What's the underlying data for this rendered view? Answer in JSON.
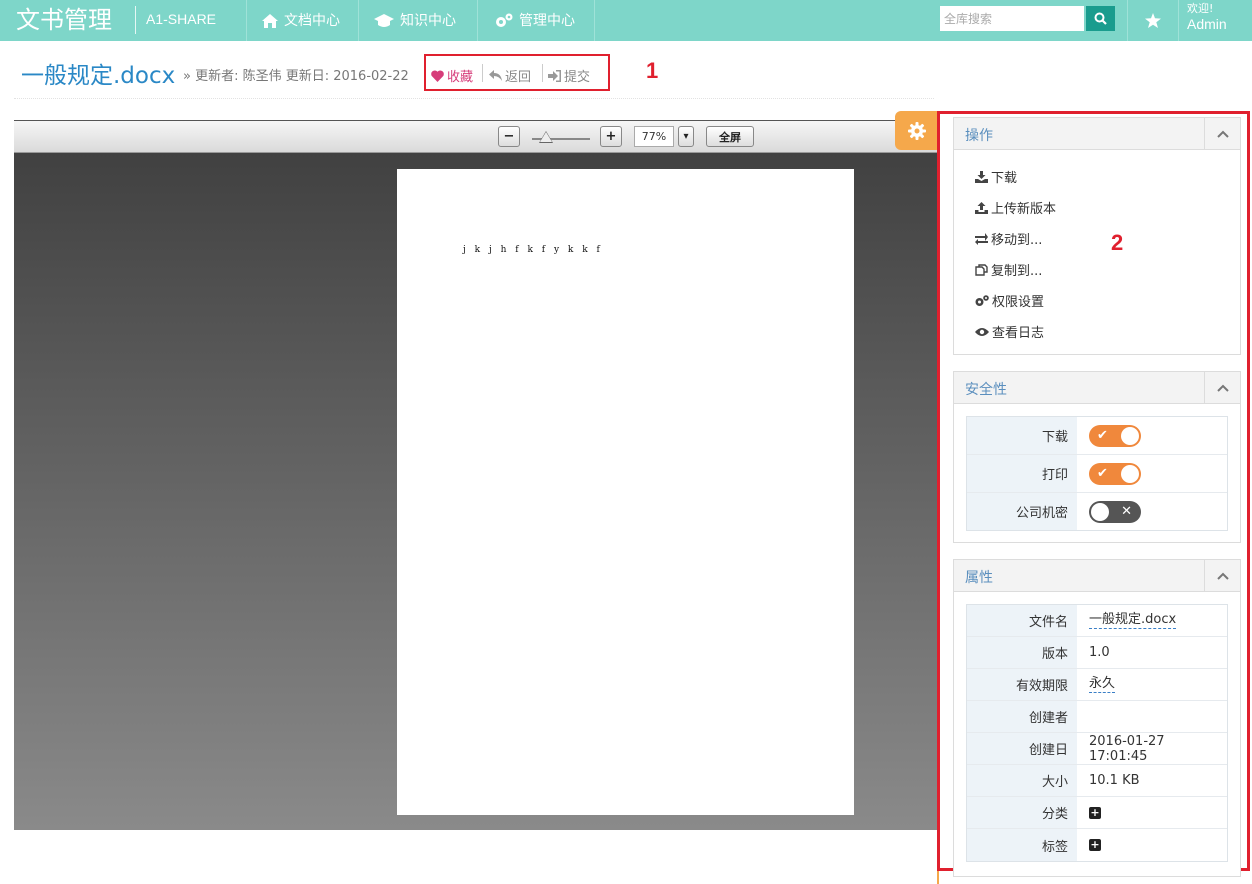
{
  "nav": {
    "brand": "文书管理",
    "brand_sub": "A1-SHARE",
    "items": [
      {
        "label": "文档中心",
        "icon": "home-icon"
      },
      {
        "label": "知识中心",
        "icon": "graduation-cap-icon"
      },
      {
        "label": "管理中心",
        "icon": "gears-icon"
      }
    ],
    "search_placeholder": "全库搜索",
    "welcome": "欢迎!",
    "user": "Admin"
  },
  "doc": {
    "title": "一般规定.docx",
    "meta": "» 更新者: 陈圣伟 更新日: 2016-02-22",
    "actions": {
      "favorite": "收藏",
      "back": "返回",
      "submit": "提交"
    }
  },
  "annotations": {
    "one": "1",
    "two": "2"
  },
  "viewer": {
    "zoom": "77%",
    "fullscreen": "全屏",
    "zoom_out": "−",
    "zoom_in": "+",
    "dropdown": "▾",
    "page_text": "j k j h f k f y k k f"
  },
  "operations": {
    "title": "操作",
    "items": [
      {
        "label": "下载",
        "icon": "download-icon"
      },
      {
        "label": "上传新版本",
        "icon": "upload-icon"
      },
      {
        "label": "移动到...",
        "icon": "exchange-icon"
      },
      {
        "label": "复制到...",
        "icon": "copy-icon"
      },
      {
        "label": "权限设置",
        "icon": "gears-icon"
      },
      {
        "label": "查看日志",
        "icon": "eye-icon"
      }
    ]
  },
  "security": {
    "title": "安全性",
    "rows": [
      {
        "label": "下载",
        "state": "on"
      },
      {
        "label": "打印",
        "state": "on"
      },
      {
        "label": "公司机密",
        "state": "off"
      }
    ]
  },
  "properties": {
    "title": "属性",
    "rows": [
      {
        "key": "文件名",
        "value": "一般规定.docx"
      },
      {
        "key": "版本",
        "value": "1.0"
      },
      {
        "key": "有效期限",
        "value": "永久"
      },
      {
        "key": "创建者",
        "value": ""
      },
      {
        "key": "创建日",
        "value": "2016-01-27 17:01:45"
      },
      {
        "key": "大小",
        "value": "10.1 KB"
      },
      {
        "key": "分类",
        "value": "+"
      },
      {
        "key": "标签",
        "value": "+"
      }
    ]
  },
  "colors": {
    "nav_bg": "#7ed6c9",
    "accent_orange": "#f0883c",
    "title_blue": "#2a88c6",
    "annotation_red": "#e0202e"
  }
}
